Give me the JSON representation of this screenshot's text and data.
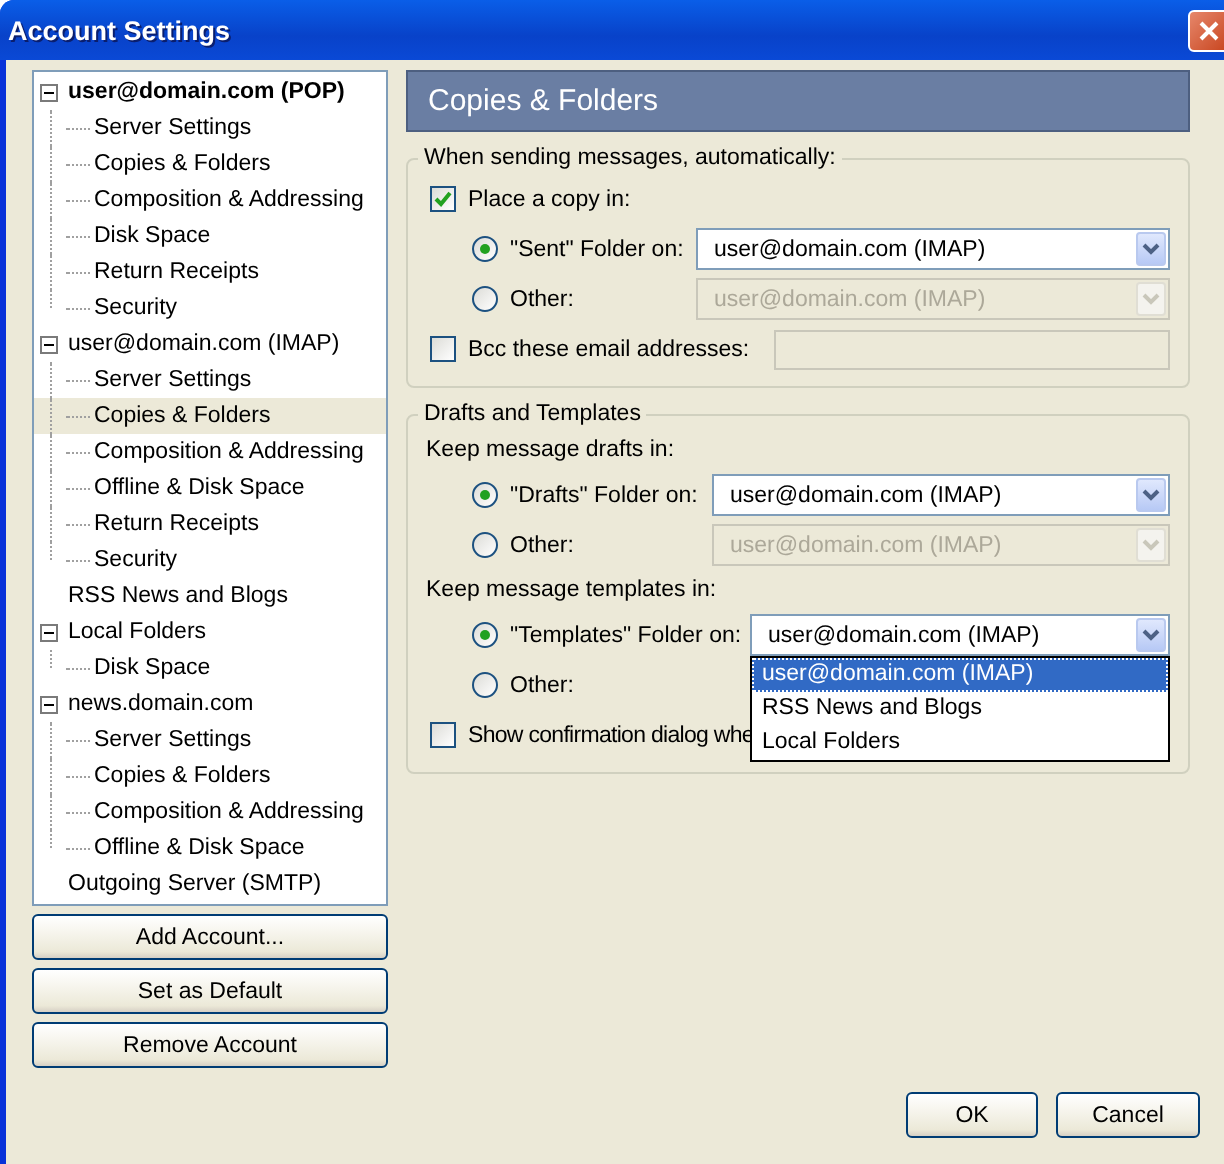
{
  "window": {
    "title": "Account Settings"
  },
  "tree": [
    {
      "label": "user@domain.com  (POP)",
      "bold": true,
      "expanded": true,
      "selected": false,
      "children": [
        {
          "label": "Server Settings",
          "selected": false
        },
        {
          "label": "Copies & Folders",
          "selected": false
        },
        {
          "label": "Composition & Addressing",
          "selected": false
        },
        {
          "label": "Disk Space",
          "selected": false
        },
        {
          "label": "Return Receipts",
          "selected": false
        },
        {
          "label": "Security",
          "selected": false
        }
      ]
    },
    {
      "label": "user@domain.com  (IMAP)",
      "bold": false,
      "expanded": true,
      "selected": false,
      "children": [
        {
          "label": "Server Settings",
          "selected": false
        },
        {
          "label": "Copies & Folders",
          "selected": true
        },
        {
          "label": "Composition & Addressing",
          "selected": false
        },
        {
          "label": "Offline & Disk Space",
          "selected": false
        },
        {
          "label": "Return Receipts",
          "selected": false
        },
        {
          "label": "Security",
          "selected": false
        }
      ]
    },
    {
      "label": "RSS News and Blogs",
      "bold": false,
      "selected": false
    },
    {
      "label": "Local Folders",
      "bold": false,
      "expanded": true,
      "selected": false,
      "children": [
        {
          "label": "Disk Space",
          "selected": false
        }
      ]
    },
    {
      "label": "news.domain.com",
      "bold": false,
      "expanded": true,
      "selected": false,
      "children": [
        {
          "label": "Server Settings",
          "selected": false
        },
        {
          "label": "Copies & Folders",
          "selected": false
        },
        {
          "label": "Composition & Addressing",
          "selected": false
        },
        {
          "label": "Offline & Disk Space",
          "selected": false
        }
      ]
    },
    {
      "label": "Outgoing Server (SMTP)",
      "bold": false,
      "selected": false
    }
  ],
  "account_buttons": [
    "Add Account...",
    "Set as Default",
    "Remove Account"
  ],
  "panel": {
    "title": "Copies & Folders",
    "sending": {
      "legend": "When sending messages, automatically:",
      "place_copy": {
        "label": "Place a copy in:",
        "checked": true
      },
      "options": [
        {
          "label": "\"Sent\" Folder on:",
          "selected": true,
          "dropdown": {
            "value": "user@domain.com  (IMAP)",
            "disabled": false
          }
        },
        {
          "label": "Other:",
          "selected": false,
          "dropdown": {
            "value": "user@domain.com  (IMAP)",
            "disabled": true
          }
        }
      ],
      "bcc": {
        "label": "Bcc these email addresses:",
        "checked": false,
        "field_disabled": true
      }
    },
    "drafts": {
      "legend": "Drafts and Templates",
      "drafts_label": "Keep message drafts in:",
      "drafts_options": [
        {
          "label": "\"Drafts\" Folder on:",
          "selected": true,
          "dropdown": {
            "value": "user@domain.com  (IMAP)",
            "disabled": false
          }
        },
        {
          "label": "Other:",
          "selected": false,
          "dropdown": {
            "value": "user@domain.com  (IMAP)",
            "disabled": true
          }
        }
      ],
      "templates_label": "Keep message templates in:",
      "templates_options": [
        {
          "label": "\"Templates\" Folder on:",
          "selected": true,
          "dropdown": {
            "value": "user@domain.com  (IMAP)",
            "disabled": false,
            "open": true,
            "items": [
              {
                "label": "user@domain.com  (IMAP)",
                "selected": true
              },
              {
                "label": "RSS News and Blogs",
                "selected": false
              },
              {
                "label": "Local Folders",
                "selected": false
              }
            ]
          }
        },
        {
          "label": "Other:",
          "selected": false
        }
      ],
      "confirm": {
        "label": "Show confirmation dialog whe",
        "checked": false
      }
    }
  },
  "dialog_buttons": [
    "OK",
    "Cancel"
  ]
}
